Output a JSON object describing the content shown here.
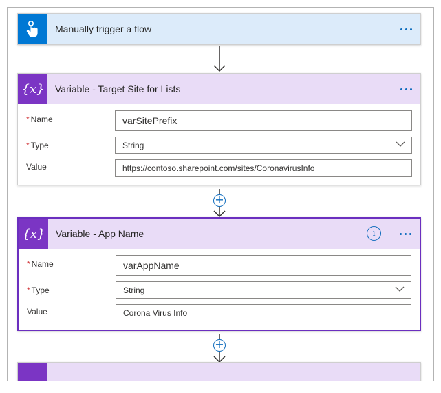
{
  "steps": [
    {
      "title": "Manually trigger a flow",
      "icon": "touch-hand-icon"
    },
    {
      "title": "Variable - Target Site for Lists",
      "icon": "variable-icon",
      "icon_glyph": "{x}",
      "name_label": "Name",
      "name_value": "varSitePrefix",
      "type_label": "Type",
      "type_value": "String",
      "value_label": "Value",
      "value_value": "https://contoso.sharepoint.com/sites/CoronavirusInfo"
    },
    {
      "title": "Variable - App Name",
      "icon": "variable-icon",
      "icon_glyph": "{x}",
      "info_glyph": "i",
      "name_label": "Name",
      "name_value": "varAppName",
      "type_label": "Type",
      "type_value": "String",
      "value_label": "Value",
      "value_value": "Corona Virus Info"
    }
  ],
  "required_marker": "*",
  "add_glyph": "+",
  "colors": {
    "trigger_header": "#dcebfa",
    "trigger_icon": "#0078d4",
    "variable_header": "#e9dcf7",
    "variable_icon": "#7b35c4",
    "selected_border": "#6b2fbf",
    "link_blue": "#0f6cbd",
    "required": "#d13438"
  }
}
